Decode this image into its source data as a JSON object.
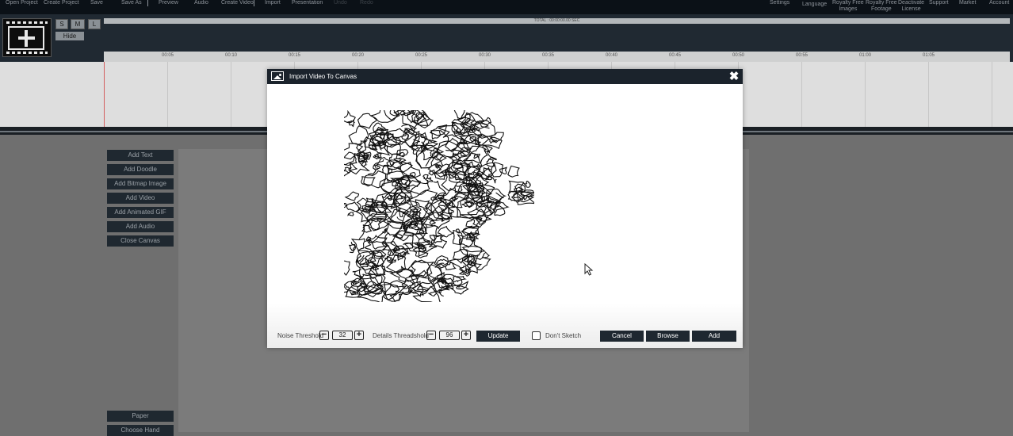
{
  "menu": {
    "open_project": "Open Project",
    "create_project": "Create Project",
    "save": "Save",
    "save_as": "Save As",
    "preview": "Preview",
    "audio": "Audio",
    "create_video": "Create Video",
    "import": "Import",
    "presentation": "Presentation",
    "undo": "Undo",
    "redo": "Redo",
    "settings": "Settings",
    "language": "Language",
    "royalty_images": "Royalty Free\nImages",
    "royalty_footage": "Royalty Free\nFootage",
    "deactivate_license": "Deactivate\nLicense",
    "support": "Support",
    "market": "Market",
    "account": "Account"
  },
  "timeline": {
    "size_buttons": [
      "S",
      "M",
      "L"
    ],
    "hide_label": "Hide",
    "total_label": "TOTAL : 00:00:00.00 SEC",
    "ticks": [
      "00:05",
      "00:10",
      "00:15",
      "00:20",
      "00:25",
      "00:30",
      "00:35",
      "00:40",
      "00:45",
      "00:50",
      "00:55",
      "01:00",
      "01:05"
    ]
  },
  "actions": {
    "add_text": "Add Text",
    "add_doodle": "Add Doodle",
    "add_bitmap": "Add Bitmap Image",
    "add_video": "Add Video",
    "add_gif": "Add Animated GIF",
    "add_audio": "Add Audio",
    "close_canvas": "Close Canvas",
    "paper": "Paper",
    "choose_hand": "Choose Hand"
  },
  "modal": {
    "title": "Import Video To Canvas",
    "noise_label": "Noise Threshold",
    "noise_value": "32",
    "details_label": "Details Threadshold",
    "details_value": "96",
    "update_label": "Update",
    "dont_sketch_label": "Don't Sketch",
    "dont_sketch_checked": false,
    "cancel_label": "Cancel",
    "browse_label": "Browse",
    "add_label": "Add"
  },
  "colors": {
    "topbar": "#0b1117",
    "dark_button": "#1e2730",
    "workspace": "#6f6f6f"
  }
}
